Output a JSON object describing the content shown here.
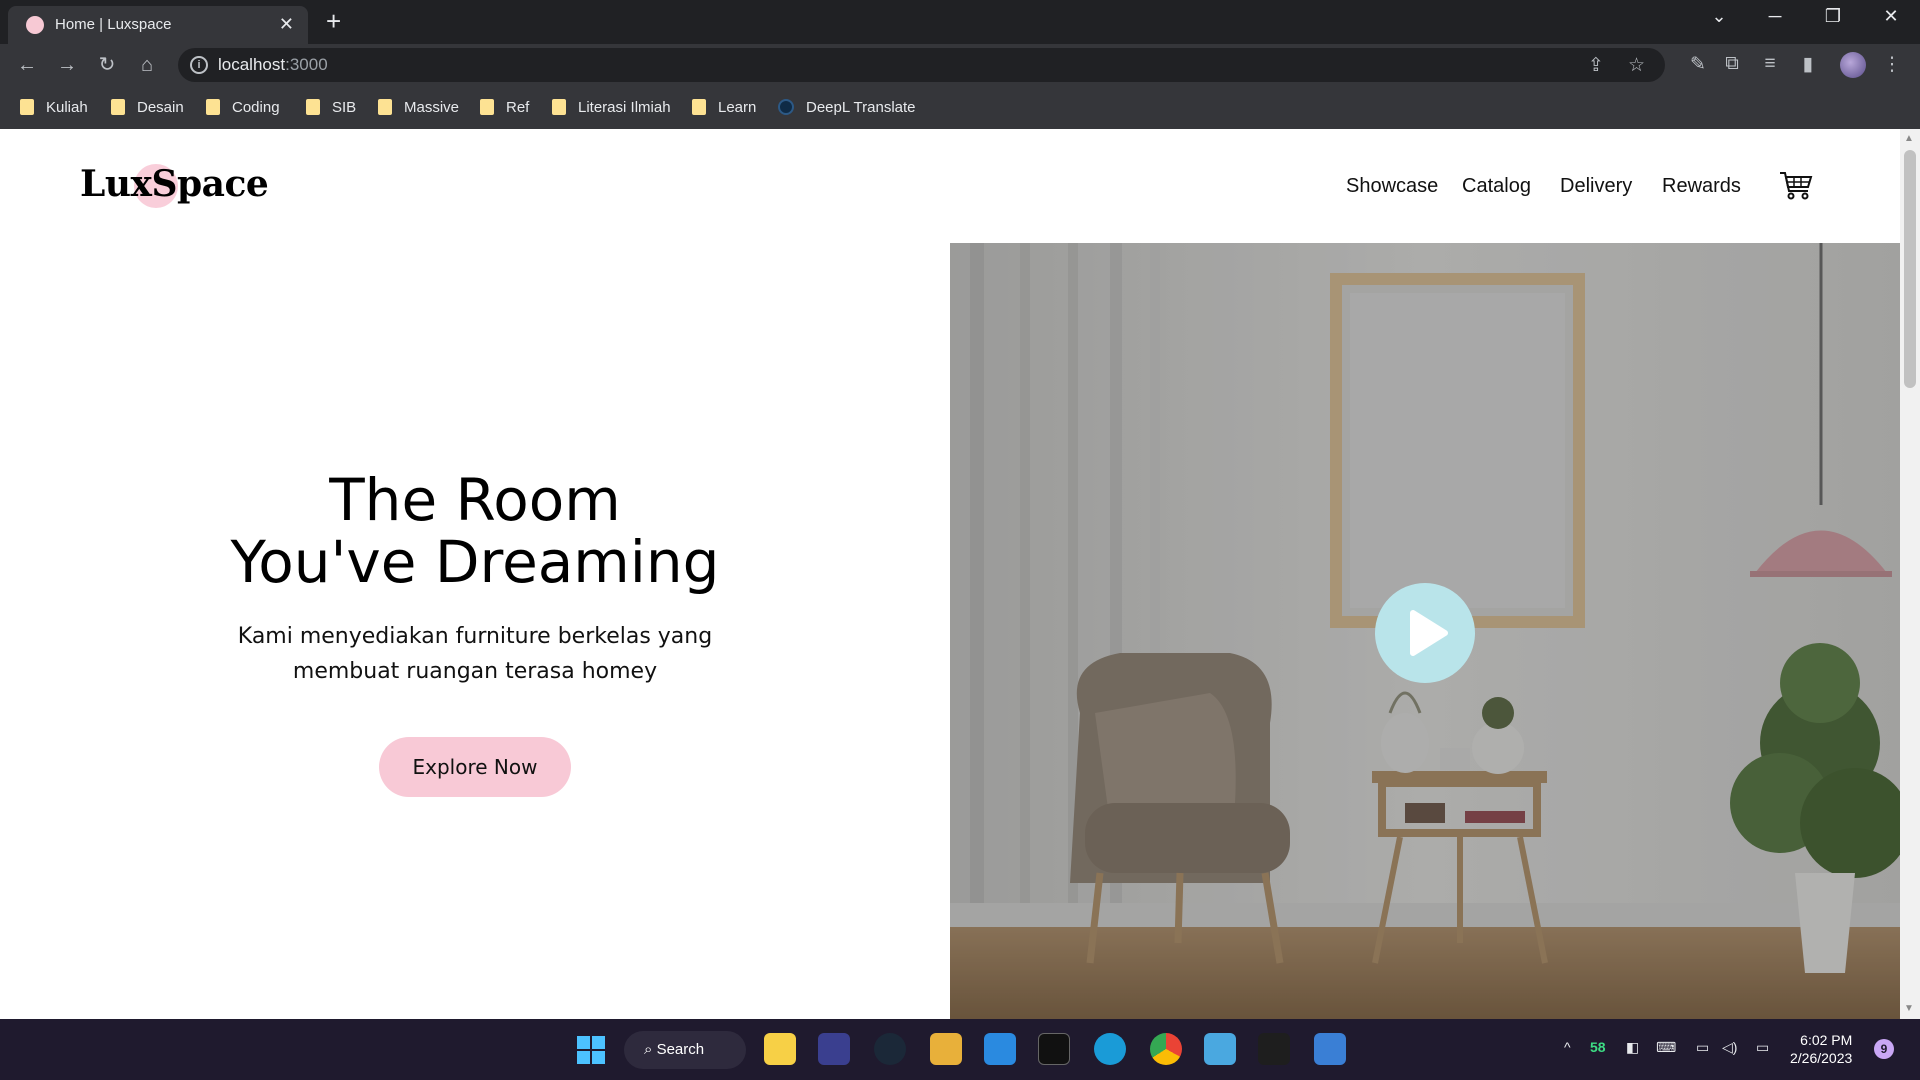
{
  "browser": {
    "tab_title": "Home | Luxspace",
    "url_host": "localhost",
    "url_port": ":3000",
    "bookmarks": [
      {
        "label": "Kuliah",
        "icon": "folder-icon"
      },
      {
        "label": "Desain",
        "icon": "folder-icon"
      },
      {
        "label": "Coding",
        "icon": "folder-icon"
      },
      {
        "label": "SIB",
        "icon": "folder-icon"
      },
      {
        "label": "Massive",
        "icon": "folder-icon"
      },
      {
        "label": "Ref",
        "icon": "folder-icon"
      },
      {
        "label": "Literasi Ilmiah",
        "icon": "folder-icon"
      },
      {
        "label": "Learn",
        "icon": "folder-icon"
      },
      {
        "label": "DeepL Translate",
        "icon": "deepl-icon"
      }
    ]
  },
  "page": {
    "logo": "LuxSpace",
    "nav": [
      "Showcase",
      "Catalog",
      "Delivery",
      "Rewards"
    ],
    "hero": {
      "title_line1": "The Room",
      "title_line2": "You've Dreaming",
      "subtitle_line1": "Kami menyediakan furniture berkelas yang",
      "subtitle_line2": "membuat ruangan terasa homey",
      "cta": "Explore Now"
    },
    "colors": {
      "accent": "#f8c9d6",
      "play_button": "#b9e4ea"
    }
  },
  "taskbar": {
    "search_label": "Search",
    "tray_number": "58",
    "time": "6:02 PM",
    "date": "2/26/2023",
    "notifications": "9"
  }
}
